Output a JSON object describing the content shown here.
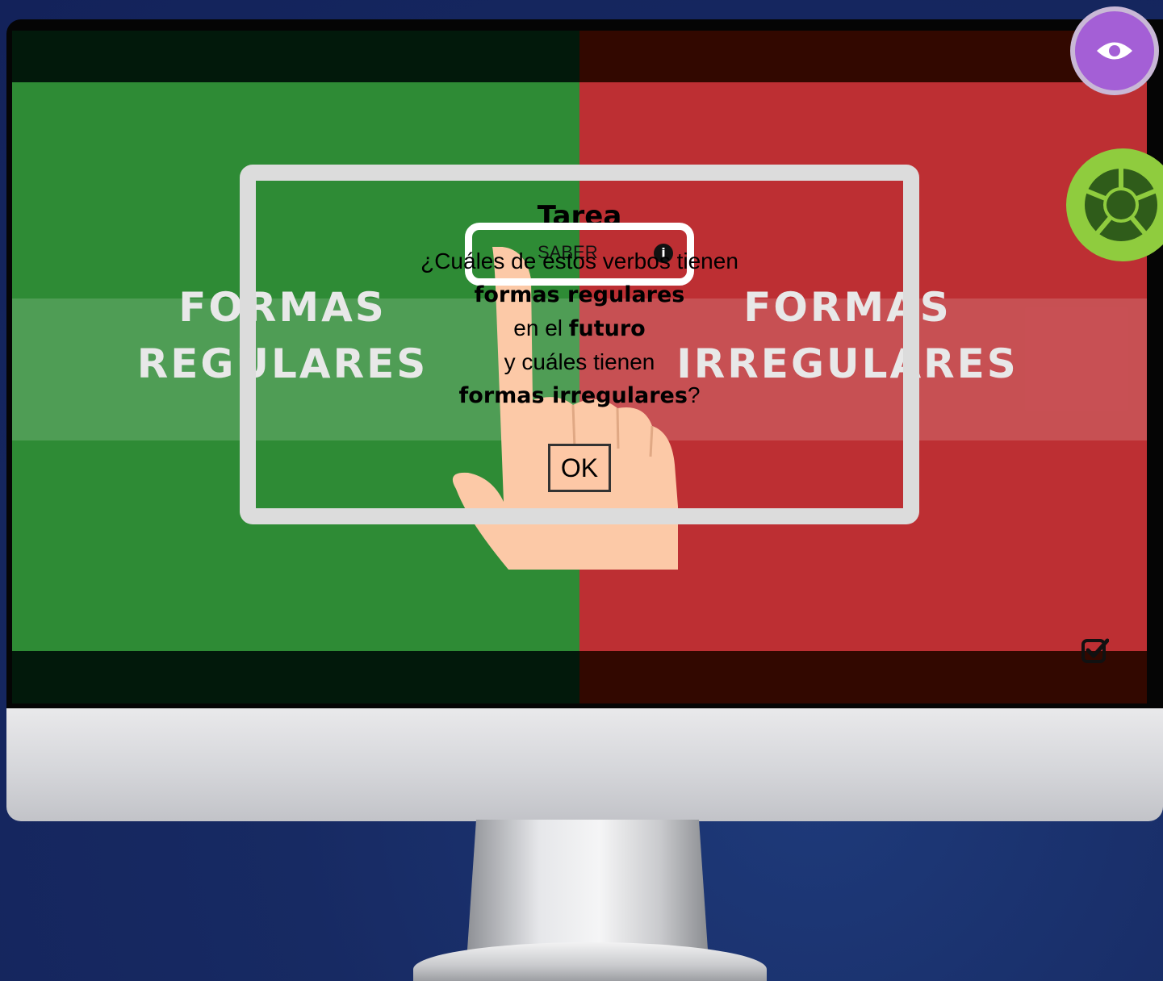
{
  "screen": {
    "left_label": [
      "FORMAS",
      "REGULARES"
    ],
    "right_label": [
      "FORMAS",
      "IRREGULARES"
    ]
  },
  "modal": {
    "title": "Tarea",
    "category": "SABER",
    "question": {
      "line1": "¿Cuáles de estos verbos tienen",
      "line2_bold": "formas regulares",
      "line3_prefix": "en el ",
      "line3_bold": "futuro",
      "line4": "y cuáles tienen",
      "line5_bold": "formas irregulares",
      "line5_suffix": "?"
    },
    "ok_label": "OK"
  },
  "icons": {
    "eye": "eye-icon",
    "wheel": "activity-wheel-icon",
    "info": "info-icon",
    "check": "checkbox-checked-icon",
    "hand": "pointing-hand-illustration"
  },
  "colors": {
    "green_panel": "#2e8b35",
    "red_panel": "#bd2f33",
    "eye_button": "#a45fd6",
    "wheel_button": "#8fcc3e"
  }
}
